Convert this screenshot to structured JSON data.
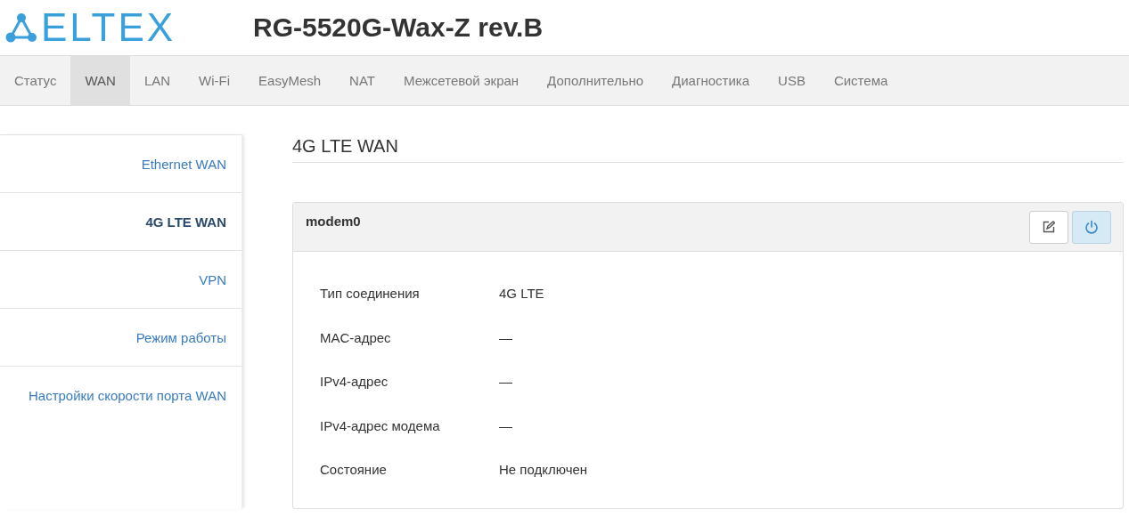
{
  "logo": {
    "text": "ELTEX"
  },
  "device_title": "RG-5520G-Wax-Z rev.B",
  "tabs": [
    {
      "label": "Статус",
      "selected": false
    },
    {
      "label": "WAN",
      "selected": true
    },
    {
      "label": "LAN",
      "selected": false
    },
    {
      "label": "Wi-Fi",
      "selected": false
    },
    {
      "label": "EasyMesh",
      "selected": false
    },
    {
      "label": "NAT",
      "selected": false
    },
    {
      "label": "Межсетевой экран",
      "selected": false
    },
    {
      "label": "Дополнительно",
      "selected": false
    },
    {
      "label": "Диагностика",
      "selected": false
    },
    {
      "label": "USB",
      "selected": false
    },
    {
      "label": "Система",
      "selected": false
    }
  ],
  "sidebar": {
    "items": [
      {
        "label": "Ethernet WAN",
        "selected": false
      },
      {
        "label": "4G LTE WAN",
        "selected": true
      },
      {
        "label": "VPN",
        "selected": false
      },
      {
        "label": "Режим работы",
        "selected": false
      },
      {
        "label": "Настройки скорости порта WAN",
        "selected": false
      }
    ]
  },
  "section_title": "4G LTE WAN",
  "panel": {
    "title": "modem0",
    "power_on": true,
    "rows": [
      {
        "label": "Тип соединения",
        "value": "4G LTE"
      },
      {
        "label": "MAC-адрес",
        "value": "—"
      },
      {
        "label": "IPv4-адрес",
        "value": "—"
      },
      {
        "label": "IPv4-адрес модема",
        "value": "—"
      },
      {
        "label": "Состояние",
        "value": "Не подключен"
      }
    ]
  }
}
